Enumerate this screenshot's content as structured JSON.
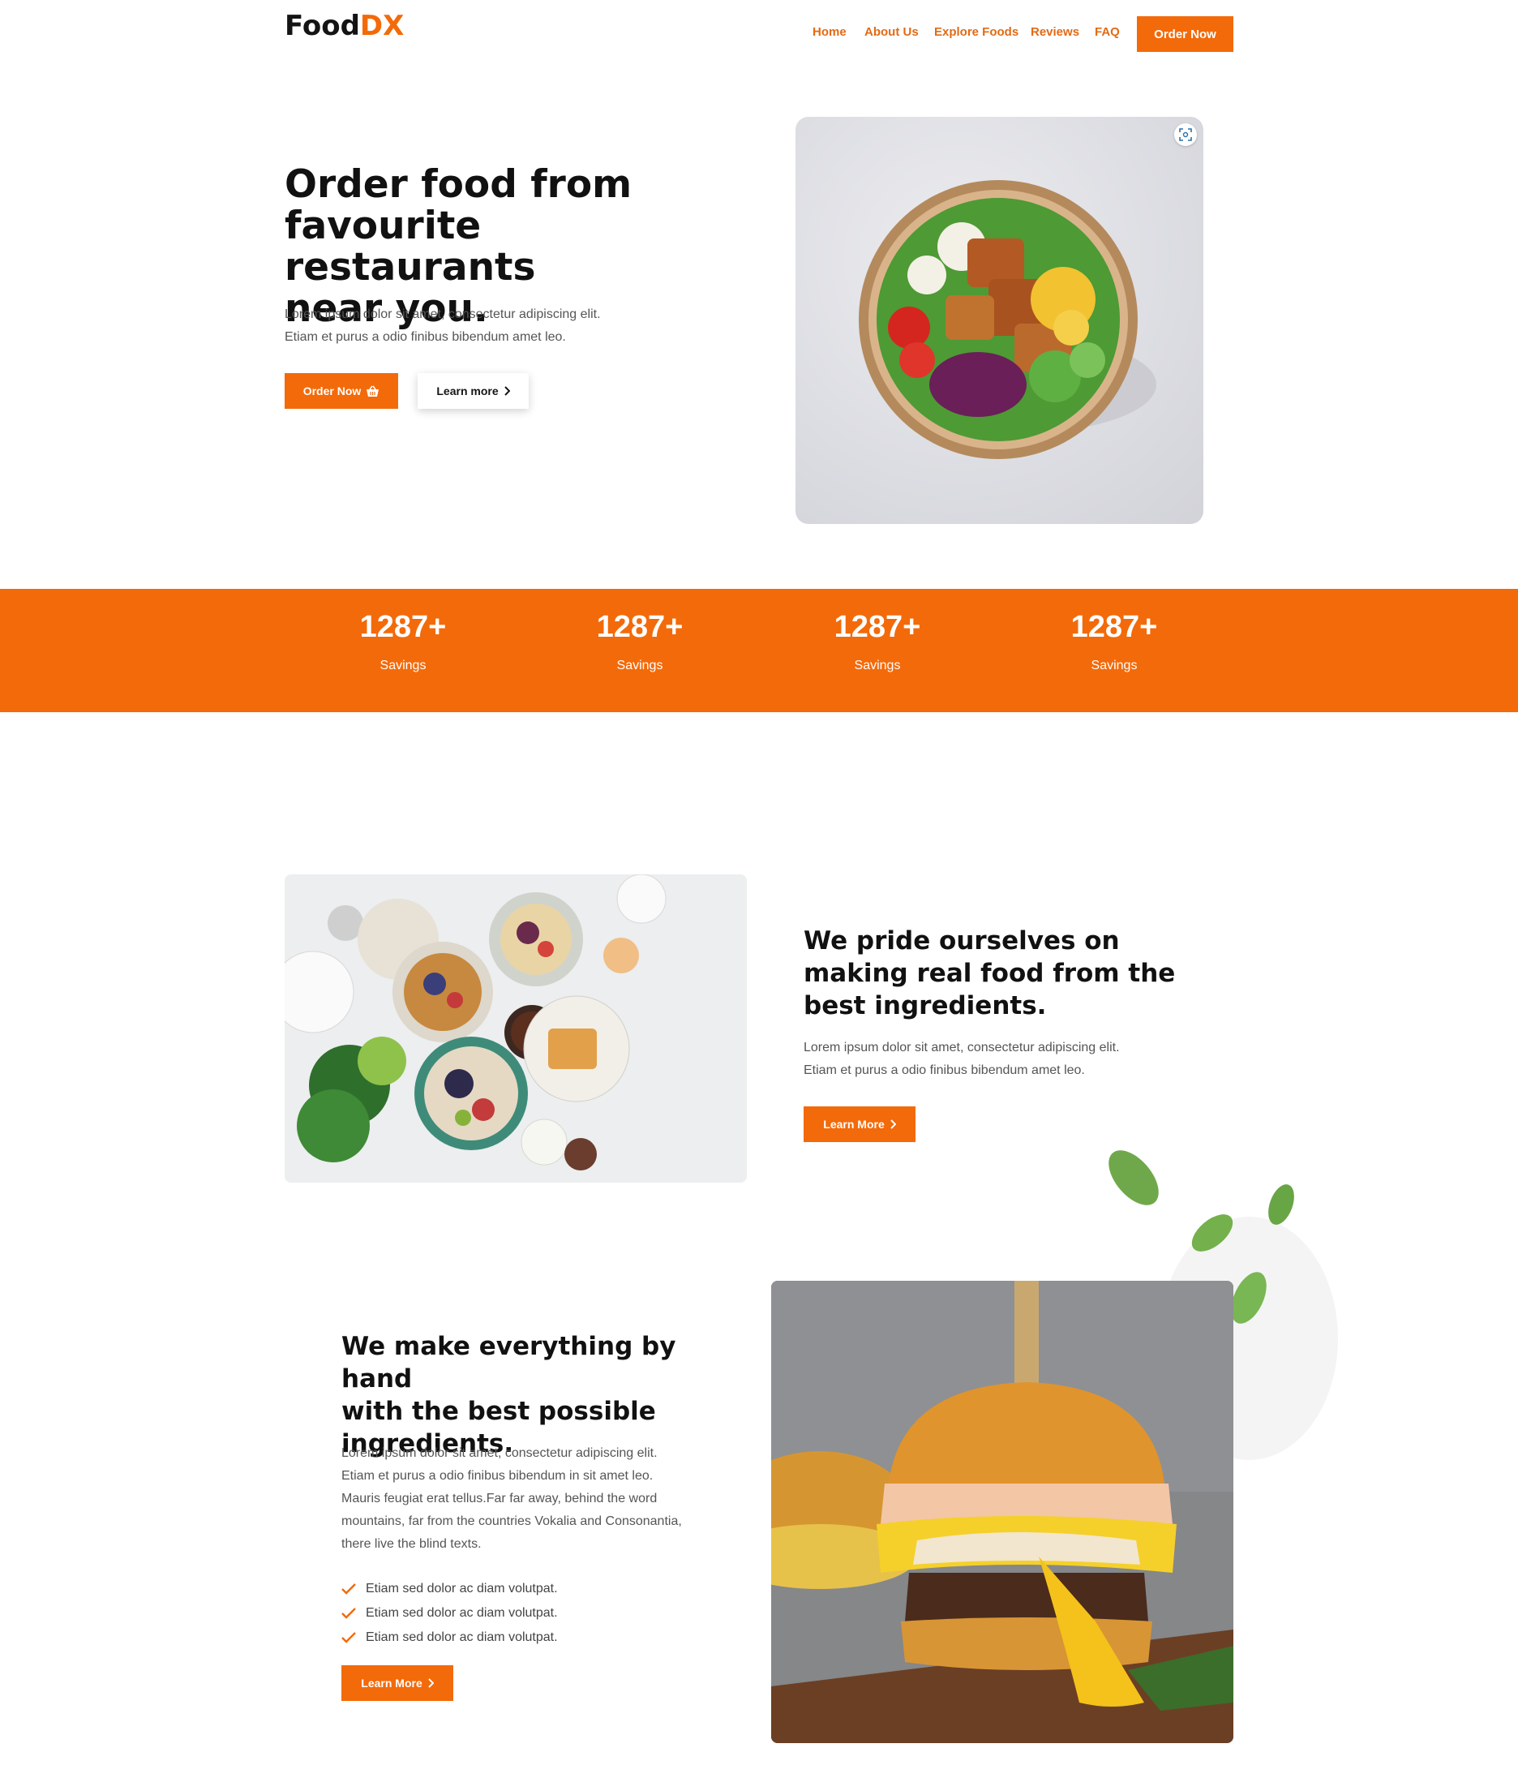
{
  "header": {
    "logo_main": "Food",
    "logo_accent": "DX",
    "nav": [
      "Home",
      "About Us",
      "Explore Foods",
      "Reviews",
      "FAQ"
    ],
    "cta": "Order Now"
  },
  "hero": {
    "title_lines": [
      "Order food from",
      "favourite restaurants",
      "near you."
    ],
    "paragraph_lines": [
      "Lorem ipsum dolor sit amet, consectetur adipiscing elit.",
      "Etiam et purus a odio finibus bibendum amet leo."
    ],
    "primary_button": "Order Now",
    "secondary_button": "Learn more"
  },
  "stats": [
    {
      "value": "1287+",
      "label": "Savings"
    },
    {
      "value": "1287+",
      "label": "Savings"
    },
    {
      "value": "1287+",
      "label": "Savings"
    },
    {
      "value": "1287+",
      "label": "Savings"
    }
  ],
  "section_pride": {
    "title_lines": [
      "We pride ourselves on",
      "making real food from the",
      "best ingredients."
    ],
    "paragraph_lines": [
      "Lorem ipsum dolor sit amet, consectetur adipiscing elit.",
      "Etiam et purus a odio finibus bibendum amet leo."
    ],
    "button": "Learn More"
  },
  "section_hand": {
    "title_lines": [
      "We make everything by hand",
      "with the best possible",
      "ingredients."
    ],
    "paragraph_lines": [
      "Lorem ipsum dolor sit amet, consectetur adipiscing elit.",
      "Etiam et purus a odio finibus bibendum in sit amet leo.",
      "Mauris feugiat erat tellus.Far far away, behind the word",
      "mountains, far from the countries Vokalia and Consonantia,",
      "there live the blind texts."
    ],
    "checklist": [
      "Etiam sed dolor ac diam volutpat.",
      "Etiam sed dolor ac diam volutpat.",
      "Etiam sed dolor ac diam volutpat."
    ],
    "button": "Learn More"
  },
  "colors": {
    "accent": "#f36a0a",
    "nav_text": "#e36a14",
    "heading": "#111111",
    "body_text": "#555555"
  },
  "icons": [
    "basket-icon",
    "chevron-right-icon",
    "scan-icon",
    "check-icon"
  ]
}
